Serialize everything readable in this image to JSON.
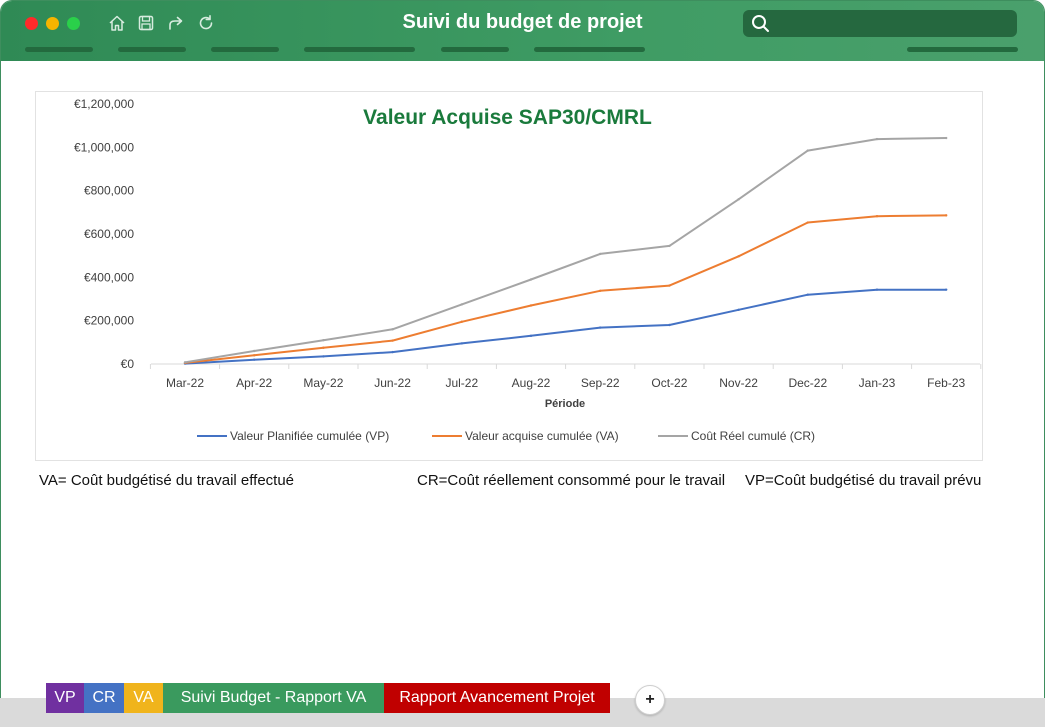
{
  "window": {
    "title": "Suivi du budget de projet",
    "controls": [
      "close",
      "minimize",
      "maximize"
    ],
    "toolbar_icons": [
      "home-icon",
      "save-icon",
      "share-icon",
      "refresh-icon"
    ],
    "search": {
      "placeholder": "",
      "icon": "search-icon"
    }
  },
  "chart_data": {
    "type": "line",
    "title": "Valeur Acquise SAP30/CMRL",
    "xlabel": "Période",
    "ylabel": "",
    "x": [
      "Mar-22",
      "Apr-22",
      "May-22",
      "Jun-22",
      "Jul-22",
      "Aug-22",
      "Sep-22",
      "Oct-22",
      "Nov-22",
      "Dec-22",
      "Jan-23",
      "Feb-23"
    ],
    "ylim": [
      0,
      1200000
    ],
    "yticks": [
      "€0",
      "€200,000",
      "€400,000",
      "€600,000",
      "€800,000",
      "€1,000,000",
      "€1,200,000"
    ],
    "grid": false,
    "legend_position": "bottom",
    "series": [
      {
        "name": "Valeur Planifiée cumulée (VP)",
        "color": "#4472c4",
        "values": [
          2000,
          20000,
          35000,
          55000,
          95000,
          130000,
          168000,
          180000,
          250000,
          320000,
          343000,
          343000
        ]
      },
      {
        "name": "Valeur acquise cumulée (VA)",
        "color": "#ed7d31",
        "values": [
          5000,
          40000,
          75000,
          108000,
          195000,
          270000,
          338000,
          362000,
          497000,
          653000,
          682000,
          686000
        ]
      },
      {
        "name": "Coût Réel cumulé  (CR)",
        "color": "#a5a5a5",
        "values": [
          8000,
          60000,
          110000,
          160000,
          275000,
          390000,
          508000,
          545000,
          760000,
          985000,
          1038000,
          1043000
        ]
      }
    ]
  },
  "notes": {
    "va": "VA= Coût budgétisé du travail effectué",
    "cr": "CR=Coût réellement consommé pour le travail",
    "vp": "VP=Coût budgétisé du travail prévu"
  },
  "sheet_tabs": [
    {
      "label": "VP",
      "color": "#7030a0"
    },
    {
      "label": "CR",
      "color": "#4472c4"
    },
    {
      "label": "VA",
      "color": "#f0b41c"
    },
    {
      "label": "Suivi Budget - Rapport VA",
      "color": "#3a9a5e"
    },
    {
      "label": "Rapport Avancement Projet",
      "color": "#c00000"
    }
  ],
  "add_sheet_label": "+"
}
